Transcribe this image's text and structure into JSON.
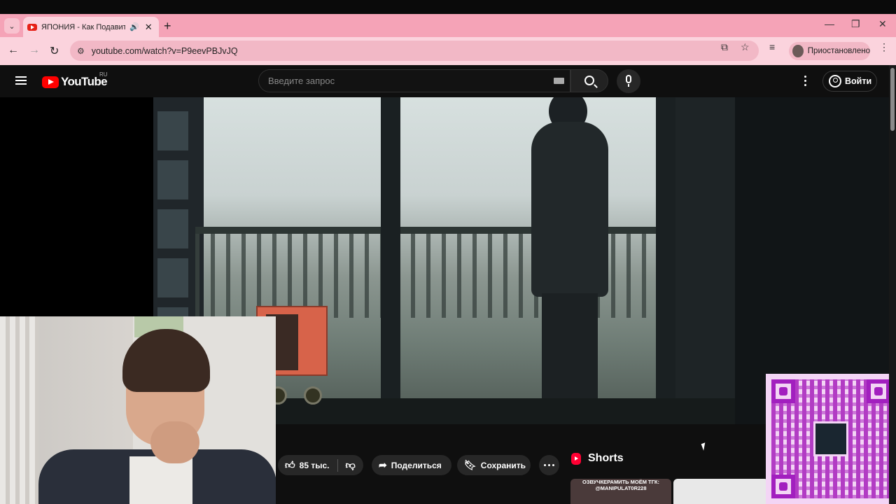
{
  "browser": {
    "tab_title": "ЯПОНИЯ - Как Подавить Н",
    "url": "youtube.com/watch?v=P9eevPBJvJQ",
    "profile_status": "Приостановлено",
    "icons": [
      "tab-search-icon",
      "speaker-icon",
      "close-icon",
      "new-tab-icon",
      "back-icon",
      "forward-icon",
      "reload-icon",
      "site-info-icon",
      "install-icon",
      "star-icon",
      "media-icon",
      "menu-icon"
    ]
  },
  "youtube": {
    "logo_text": "YouTube",
    "region": "RU",
    "search_placeholder": "Введите запрос",
    "signin_label": "Войти"
  },
  "actions": {
    "likes": "85 тыс.",
    "share": "Поделиться",
    "save": "Сохранить"
  },
  "shorts": {
    "title": "Shorts",
    "thumb_caption_1": "ОЗВУЧКЕРАМИТЬ МОЁМ ТГК:",
    "thumb_caption_2": "@MANIPULAT0R228"
  },
  "colors": {
    "tab_strip": "#f5a3b7",
    "toolbar": "#fbd3dd",
    "yt_red": "#ff0000",
    "qr_accent": "#a21fbf"
  }
}
